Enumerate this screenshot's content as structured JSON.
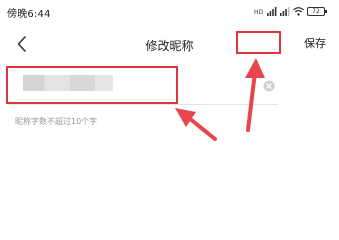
{
  "status_bar": {
    "time": "傍晚6:44",
    "battery": "72",
    "icons": [
      "hd-icon",
      "signal-icon",
      "signal-icon",
      "wifi-icon",
      "battery-icon"
    ]
  },
  "nav": {
    "back_icon": "chevron-left-icon",
    "title": "修改昵称",
    "save_label": "保存"
  },
  "input": {
    "value": "",
    "clear_icon": "clear-circle-icon"
  },
  "hint": "昵称字数不超过10个字",
  "annotations": {
    "color": "#e0343d"
  }
}
